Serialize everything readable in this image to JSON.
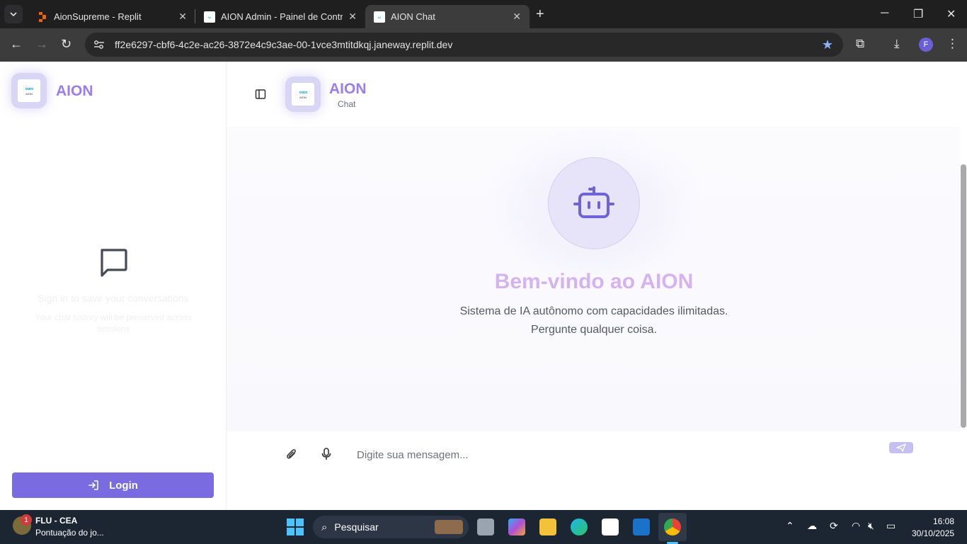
{
  "browser": {
    "tabs": [
      {
        "title": "AionSupreme - Replit"
      },
      {
        "title": "AION Admin - Painel de Controle"
      },
      {
        "title": "AION Chat"
      }
    ],
    "url": "ff2e6297-cbf6-4c2e-ac26-3872e4c9c3ae-00-1vce3mtitdkqj.janeway.replit.dev",
    "profile_initial": "F"
  },
  "sidebar": {
    "logo_text": "AION",
    "logo_caption": "AION",
    "brand": "AION",
    "empty_title": "Sign in to save your conversations",
    "empty_subtitle": "Your chat history will be preserved across sessions",
    "login_label": "Login"
  },
  "header": {
    "brand": "AION",
    "subtitle": "Chat"
  },
  "chat": {
    "welcome": "Bem-vindo ao AION",
    "tagline_line1": "Sistema de IA autônomo com capacidades ilimitadas.",
    "tagline_line2": "Pergunte qualquer coisa.",
    "input_placeholder": "Digite sua mensagem..."
  },
  "taskbar": {
    "news_badge": "1",
    "news_title": "FLU - CEA",
    "news_subtitle": "Pontuação do jo...",
    "search_label": "Pesquisar",
    "time": "16:08",
    "date": "30/10/2025"
  },
  "colors": {
    "accent": "#7a6be0",
    "brand_text": "#9a7df0",
    "welcome_text": "#d5b2f0"
  }
}
